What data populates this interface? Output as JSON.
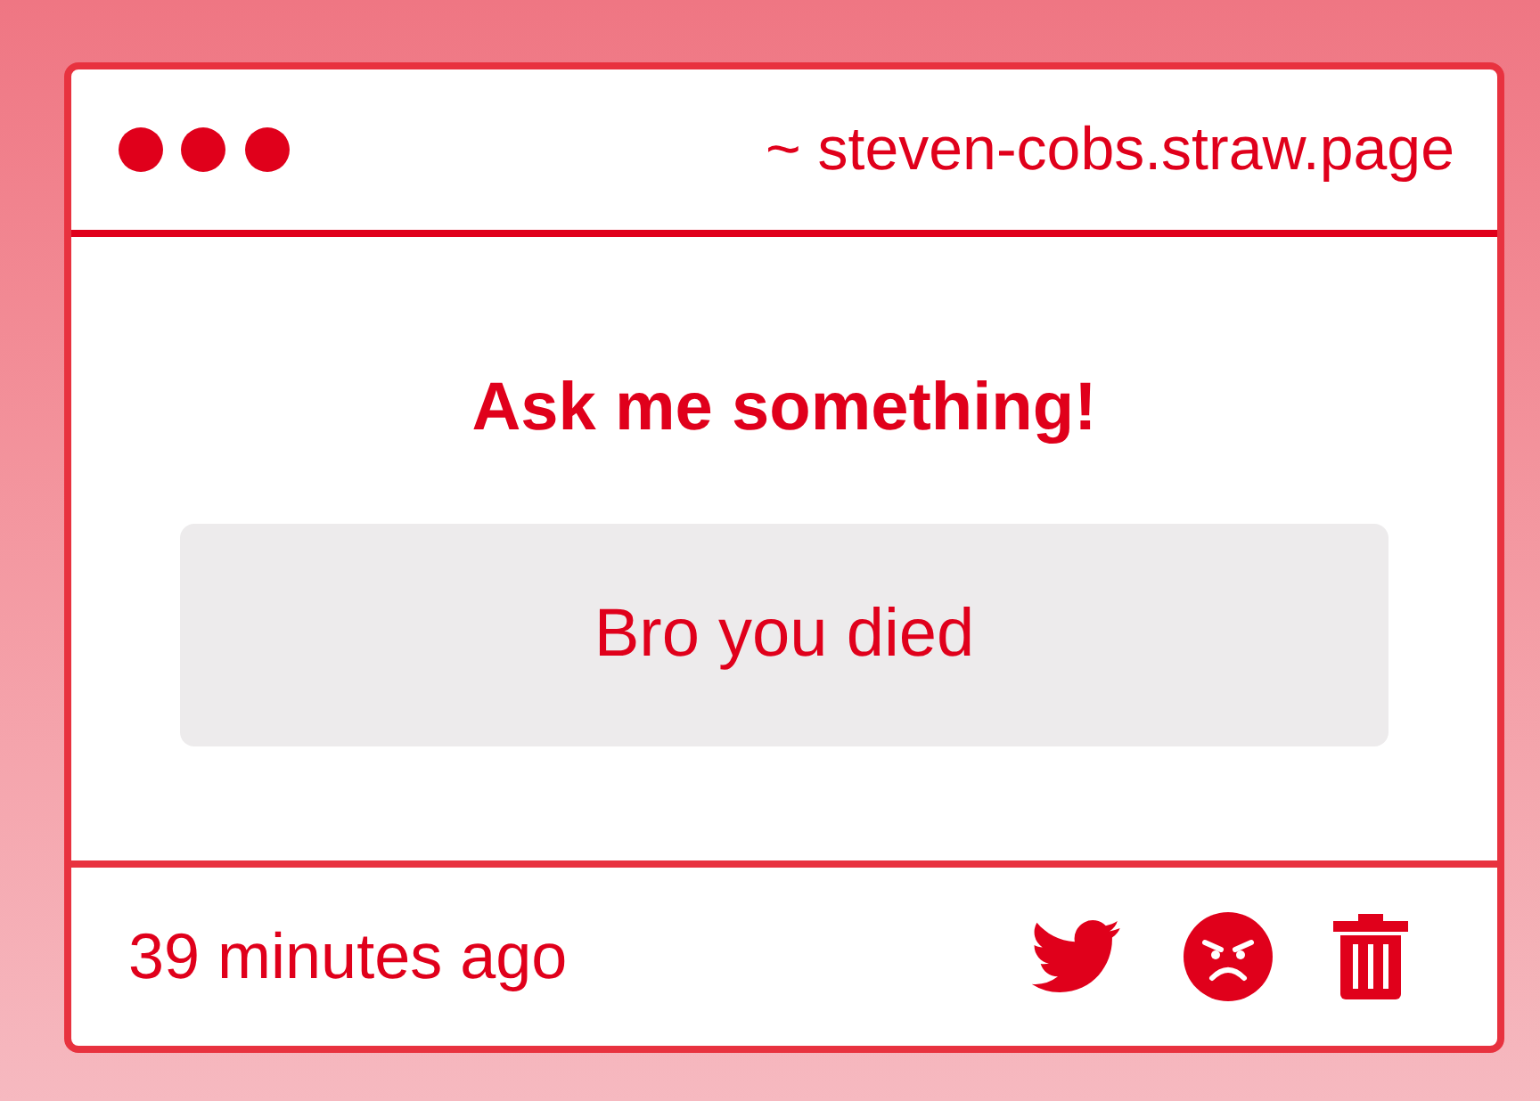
{
  "window": {
    "url": "~ steven-cobs.straw.page"
  },
  "prompt": {
    "title": "Ask me something!"
  },
  "message": {
    "text": "Bro you died"
  },
  "footer": {
    "time": "39 minutes ago"
  }
}
